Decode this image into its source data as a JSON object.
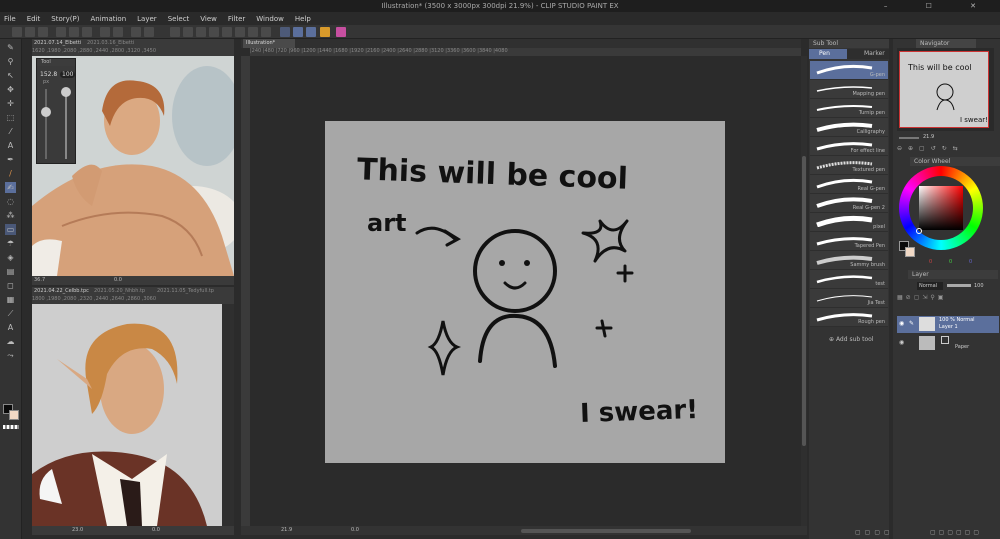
{
  "window": {
    "title": "Illustration* (3500 x 3000px 300dpi 21.9%) - CLIP STUDIO PAINT EX",
    "controls": "–  ☐  ✕"
  },
  "menu": [
    "File",
    "Edit",
    "Story(P)",
    "Animation",
    "Layer",
    "Select",
    "View",
    "Filter",
    "Window",
    "Help"
  ],
  "ref1": {
    "tab1": "2021.07.14_Elbetti",
    "tab2": "2021.03.16_Elbetti",
    "tool_label": "Tool",
    "size_value": "152.8",
    "size_unit": "px",
    "opacity_value": "100",
    "zoom": "36.7",
    "rot": "0.0",
    "ruler": "1620 ,1980 ,2080 ,2880 ,2440 ,2800 ,3120 ,3450"
  },
  "ref2": {
    "tab1": "2021.04.22_Celbb.tpc",
    "tab2": "2021.05.20_Nhbh.tp",
    "tab3": "2021.11.05_Tedyfull.tp",
    "zoom": "23.0",
    "rot": "0.0",
    "ruler": "1800 ,1980 ,2080 ,2320 ,2440 ,2640 ,2860 ,3060"
  },
  "canvas": {
    "tab": "Illustration*",
    "zoom": "21.9",
    "rot": "0.0",
    "ruler": "|240 |480 |720 |960 |1200 |1440 |1680 |1920 |2160 |2400 |2640 |2880 |3120 |3360 |3600 |3840 |4080",
    "line1": "This will be cool",
    "line2": "art",
    "line3": "I swear!"
  },
  "subtool_panel": {
    "title": "Sub Tool",
    "tabs": [
      "Pen",
      "Marker"
    ],
    "items": [
      "G-pen",
      "Mapping pen",
      "Turnip pen",
      "Calligraphy",
      "For effect line",
      "Textured pen",
      "Real G-pen",
      "Real G-pen 2",
      "pixel",
      "Tapered Pen",
      "Sammy brush",
      "test",
      "Jia Test",
      "Rough pen"
    ],
    "add_label": "Add sub tool"
  },
  "navigator": {
    "title": "Navigator",
    "zoom": "21.9"
  },
  "color_wheel": {
    "title": "Color Wheel",
    "values": [
      "0",
      "0",
      "0"
    ]
  },
  "layer_panel": {
    "title": "Layer",
    "blend": "Normal",
    "opacity": "100",
    "layers": [
      {
        "name": "Layer 1",
        "mode": "100 % Normal"
      },
      {
        "name": "Paper",
        "mode": ""
      }
    ]
  },
  "colors": {
    "accent": "#5b6f9c",
    "canvas": "#a7a7a7",
    "bg": "#2b2b2b",
    "panel": "#3a3a3a"
  }
}
